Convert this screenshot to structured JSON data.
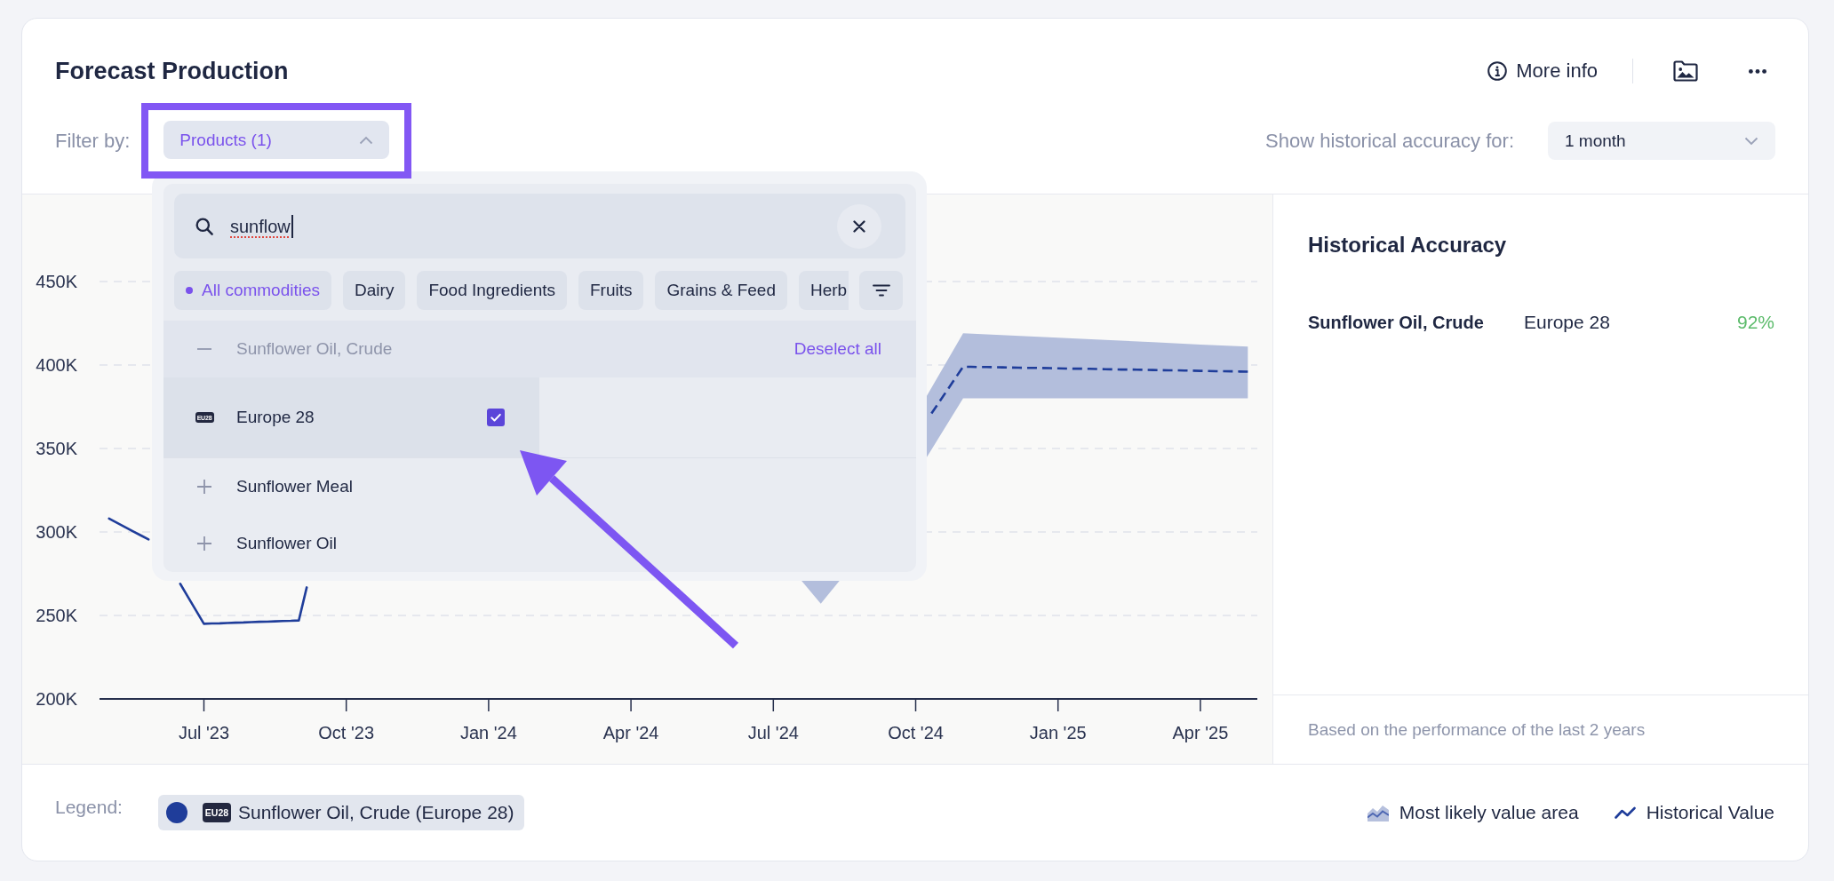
{
  "header": {
    "title": "Forecast Production",
    "more_info": "More info"
  },
  "filters": {
    "label": "Filter by:",
    "products": {
      "label": "Products (1)",
      "expanded": true,
      "highlighted": true
    }
  },
  "accuracy_period": {
    "label": "Show historical accuracy for:",
    "value": "1 month"
  },
  "dropdown": {
    "search": {
      "value": "sunflow"
    },
    "chips": [
      {
        "label": "All commodities",
        "selected": true
      },
      {
        "label": "Dairy",
        "selected": false
      },
      {
        "label": "Food Ingredients",
        "selected": false
      },
      {
        "label": "Fruits",
        "selected": false
      },
      {
        "label": "Grains & Feed",
        "selected": false
      },
      {
        "label": "Herb",
        "selected": false
      }
    ],
    "groups": [
      {
        "label": "Sunflower Oil, Crude",
        "expanded": true,
        "action": "Deselect all",
        "items": [
          {
            "badge": "EU28",
            "label": "Europe 28",
            "checked": true,
            "hovered": true
          }
        ]
      },
      {
        "label": "Sunflower Meal",
        "expanded": false
      },
      {
        "label": "Sunflower Oil",
        "expanded": false
      }
    ]
  },
  "chart": {
    "chart_data": {
      "type": "line",
      "grid": true,
      "categories": [
        null,
        null,
        null,
        null,
        null,
        null,
        null,
        null,
        null,
        null,
        null,
        null,
        "Jul '23",
        null,
        null,
        null,
        null,
        null,
        null,
        null,
        null,
        null,
        null,
        null,
        null,
        null,
        null,
        null,
        null,
        null,
        "Oct '23",
        null,
        null,
        null,
        null,
        null,
        null,
        null,
        null,
        null,
        null,
        null,
        null,
        null,
        null,
        null,
        null,
        null,
        "Jan '24",
        null,
        null,
        null,
        null,
        null,
        null,
        null,
        null,
        null,
        null,
        null,
        null,
        null,
        null,
        null,
        null,
        null,
        "Apr '24",
        null,
        null,
        null,
        null,
        null,
        null,
        null,
        null,
        null,
        null,
        null,
        null,
        null,
        null,
        null,
        null,
        null,
        "Jul '24",
        null,
        null,
        null,
        null,
        null,
        null,
        null,
        null,
        null,
        null,
        null,
        null,
        null,
        null,
        null,
        null,
        null,
        "Oct '24",
        null,
        null,
        null,
        null,
        null,
        null,
        null,
        null,
        null,
        null,
        null,
        null,
        null,
        null,
        null,
        null,
        null,
        "Jan '25",
        null,
        null,
        null,
        null,
        null,
        null,
        null,
        null,
        null,
        null,
        null,
        null,
        null,
        null,
        null,
        null,
        null,
        "Apr '25",
        null,
        null,
        null,
        null,
        null,
        null
      ],
      "ylim": [
        200,
        450
      ],
      "yticks": [
        {
          "value": 200,
          "label": "200K"
        },
        {
          "value": 250,
          "label": "250K"
        },
        {
          "value": 300,
          "label": "300K"
        },
        {
          "value": 350,
          "label": "350K"
        },
        {
          "value": 400,
          "label": "400K"
        },
        {
          "value": 450,
          "label": "450K"
        }
      ],
      "series": [
        {
          "name": "Historical Value",
          "color": "#1f3d9a",
          "line_style": "solid",
          "values": [
            308,
            305.5,
            303,
            300.5,
            298,
            295.5,
            null,
            null,
            null,
            269,
            261,
            253,
            245,
            245.2,
            245.3,
            245.5,
            245.7,
            245.8,
            246,
            246.2,
            246.3,
            246.5,
            246.7,
            246.8,
            247,
            266.8,
            null,
            null,
            null,
            null,
            null,
            null,
            null,
            null,
            null,
            null,
            null,
            null,
            null,
            null,
            null,
            null,
            null,
            null,
            null,
            null,
            null,
            null,
            null,
            null,
            null,
            null,
            null,
            null,
            null,
            null,
            null,
            null,
            null,
            null,
            null,
            null,
            null,
            null,
            null,
            null,
            null,
            null,
            null,
            null,
            null,
            null,
            null,
            null,
            null,
            null,
            null,
            null,
            null,
            null,
            null,
            null,
            null,
            null,
            null,
            null,
            null,
            null,
            null,
            null,
            null,
            null,
            null,
            null,
            null,
            null,
            null,
            null,
            null,
            null,
            null,
            null,
            null,
            null,
            null,
            null,
            null,
            null,
            null,
            null,
            null,
            null,
            null,
            null,
            null,
            null,
            null,
            null,
            null,
            null,
            null,
            null,
            null,
            null,
            null,
            null,
            null,
            null,
            null,
            null,
            null,
            null,
            null,
            null,
            null,
            null,
            null,
            null,
            null,
            null,
            null,
            null,
            null,
            null,
            null
          ]
        },
        {
          "name": "Sunflower Oil, Crude (Europe 28)",
          "color": "#1f3d9a",
          "line_style": "dashed",
          "values": [
            null,
            null,
            null,
            null,
            null,
            null,
            null,
            null,
            null,
            null,
            null,
            null,
            null,
            null,
            null,
            null,
            null,
            null,
            null,
            null,
            null,
            null,
            null,
            null,
            null,
            null,
            null,
            null,
            null,
            null,
            null,
            null,
            null,
            null,
            null,
            null,
            null,
            null,
            null,
            null,
            null,
            null,
            null,
            null,
            null,
            null,
            null,
            null,
            null,
            null,
            null,
            null,
            null,
            null,
            null,
            null,
            null,
            null,
            null,
            null,
            null,
            null,
            null,
            null,
            null,
            null,
            null,
            null,
            null,
            null,
            null,
            null,
            null,
            null,
            null,
            null,
            null,
            null,
            null,
            null,
            null,
            null,
            null,
            null,
            null,
            null,
            null,
            null,
            null,
            null,
            null,
            null,
            null,
            null,
            null,
            null,
            null,
            null,
            null,
            null,
            null,
            null,
            null,
            null,
            371,
            378,
            385,
            392,
            399,
            398.9,
            398.8,
            398.8,
            398.7,
            398.6,
            398.5,
            398.4,
            398.3,
            398.3,
            398.2,
            398.1,
            398,
            397.9,
            397.8,
            397.8,
            397.7,
            397.6,
            397.5,
            397.4,
            397.3,
            397.3,
            397.2,
            397.1,
            397,
            396.9,
            396.8,
            396.8,
            396.7,
            396.6,
            396.5,
            396.4,
            396.3,
            396.3,
            396.2,
            396.1,
            396
          ]
        }
      ]
    }
  },
  "accuracy": {
    "title": "Historical Accuracy",
    "rows": [
      {
        "product": "Sunflower Oil, Crude",
        "region": "Europe 28",
        "value": "92%"
      }
    ],
    "note": "Based on the performance of the last 2 years"
  },
  "legend": {
    "label": "Legend:",
    "badge": "EU28",
    "area_key": "Most likely value area"
  }
}
